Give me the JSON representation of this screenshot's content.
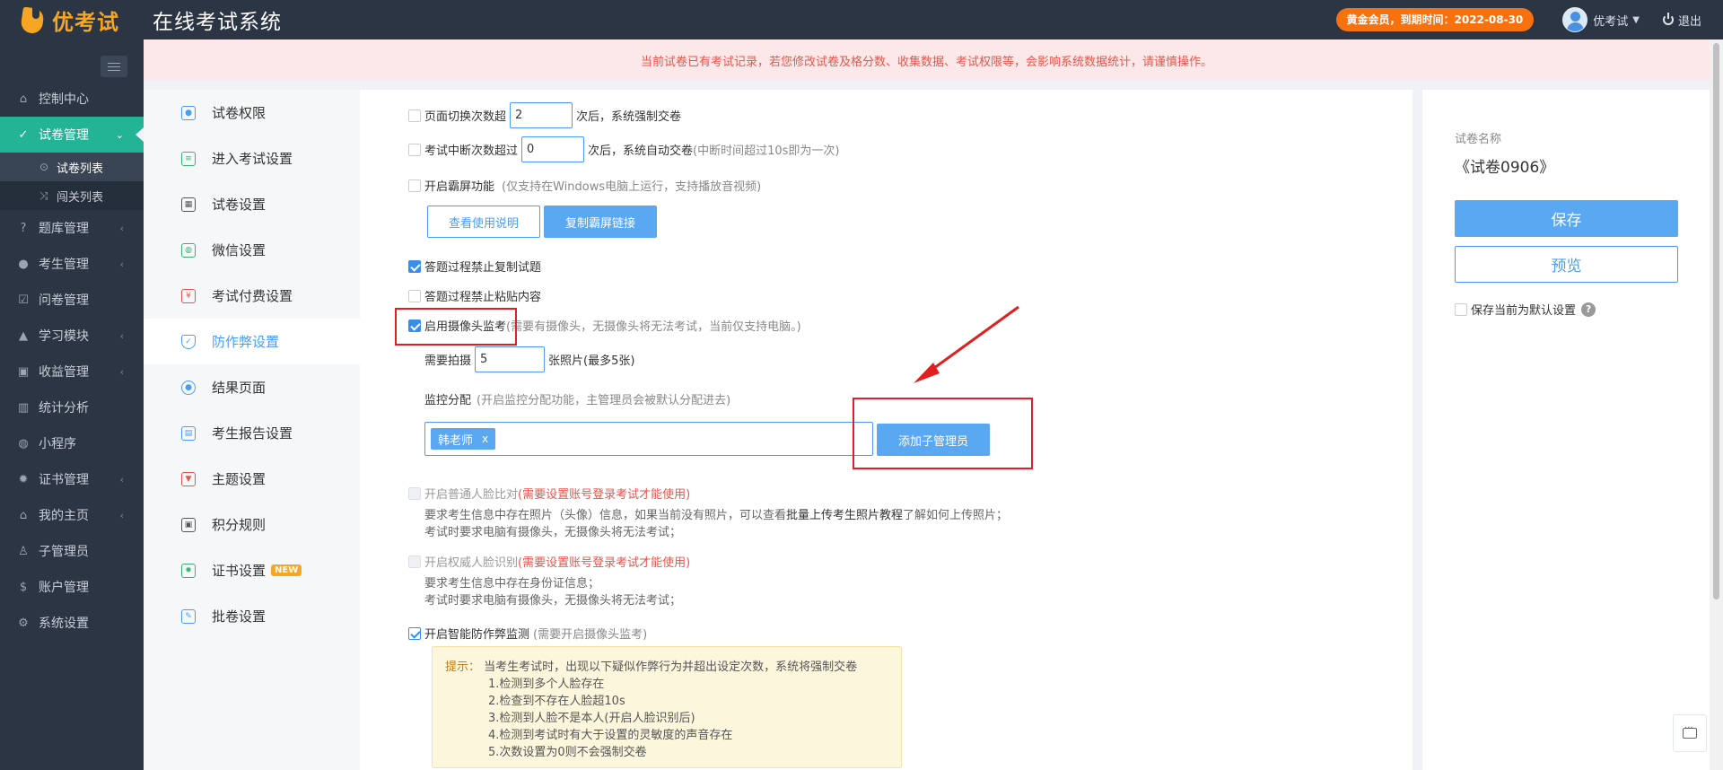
{
  "topbar": {
    "logo_text": "优考试",
    "system_title": "在线考试系统",
    "member_badge": "黄金会员，到期时间：2022-08-30",
    "username": "优考试",
    "logout": "退出"
  },
  "nav": {
    "items": [
      {
        "label": "控制中心",
        "icon": "home-icon"
      },
      {
        "label": "试卷管理",
        "icon": "check-circle-icon",
        "active": true
      },
      {
        "label": "题库管理",
        "icon": "question-icon"
      },
      {
        "label": "考生管理",
        "icon": "user-icon"
      },
      {
        "label": "问卷管理",
        "icon": "checkbox-icon"
      },
      {
        "label": "学习模块",
        "icon": "graduation-icon"
      },
      {
        "label": "收益管理",
        "icon": "money-icon"
      },
      {
        "label": "统计分析",
        "icon": "bar-chart-icon"
      },
      {
        "label": "小程序",
        "icon": "wechat-icon"
      },
      {
        "label": "证书管理",
        "icon": "certificate-icon"
      },
      {
        "label": "我的主页",
        "icon": "bank-icon"
      },
      {
        "label": "子管理员",
        "icon": "sub-admin-icon"
      },
      {
        "label": "账户管理",
        "icon": "dollar-icon"
      },
      {
        "label": "系统设置",
        "icon": "gear-icon"
      }
    ],
    "sub_items": [
      {
        "label": "试卷列表",
        "icon": "check-circle-icon"
      },
      {
        "label": "闯关列表",
        "icon": "shuffle-icon"
      }
    ]
  },
  "alert": {
    "text": "当前试卷已有考试记录，若您修改试卷及格分数、收集数据、考试权限等，会影响系统数据统计，请谨慎操作。"
  },
  "tabs": [
    {
      "label": "试卷权限",
      "color": "#4a9ef0"
    },
    {
      "label": "进入考试设置",
      "color": "#3cb371"
    },
    {
      "label": "试卷设置",
      "color": "#555555"
    },
    {
      "label": "微信设置",
      "color": "#3cb371"
    },
    {
      "label": "考试付费设置",
      "color": "#e2574c"
    },
    {
      "label": "防作弊设置",
      "color": "#4a9ef0",
      "active": true
    },
    {
      "label": "结果页面",
      "color": "#4a9ef0"
    },
    {
      "label": "考生报告设置",
      "color": "#4a9ef0"
    },
    {
      "label": "主题设置",
      "color": "#e2574c"
    },
    {
      "label": "积分规则",
      "color": "#555555"
    },
    {
      "label": "证书设置",
      "color": "#3cb371",
      "badge": "NEW"
    },
    {
      "label": "批卷设置",
      "color": "#4a9ef0"
    }
  ],
  "form": {
    "page_switch": {
      "label": "页面切换次数超",
      "value": "2",
      "suffix": "次后，系统强制交卷"
    },
    "interrupt": {
      "label": "考试中断次数超过",
      "value": "0",
      "suffix": "次后，系统自动交卷",
      "hint": "(中断时间超过10s即为一次)"
    },
    "fullscreen": {
      "label": "开启霸屏功能",
      "hint": "(仅支持在Windows电脑上运行，支持播放音视频)"
    },
    "view_guide_button": "查看使用说明",
    "copy_link_button": "复制霸屏链接",
    "no_copy": {
      "label": "答题过程禁止复制试题"
    },
    "no_paste": {
      "label": "答题过程禁止粘贴内容"
    },
    "camera": {
      "label": "启用摄像头监考",
      "hint": "(需要有摄像头，无摄像头将无法考试，当前仅支持电脑。)"
    },
    "photos": {
      "label": "需要拍摄",
      "value": "5",
      "suffix": "张照片(最多5张)"
    },
    "monitor": {
      "label": "监控分配",
      "hint": "(开启监控分配功能，主管理员会被默认分配进去)"
    },
    "assignee_tag": "韩老师",
    "tag_remove": "x",
    "add_sub_admin_button": "添加子管理员",
    "face_compare": {
      "label": "开启普通人脸比对",
      "hint": "(需要设置账号登录考试才能使用)",
      "desc1_pre": "要求考生信息中存在照片（头像）信息，如果当前没有照片，可以查看",
      "desc1_link": "批量上传考生照片教程",
      "desc1_post": "了解如何上传照片；",
      "desc2": "考试时要求电脑有摄像头，无摄像头将无法考试；"
    },
    "face_auth": {
      "label": "开启权威人脸识别",
      "hint": "(需要设置账号登录考试才能使用)",
      "desc1": "要求考生信息中存在身份证信息；",
      "desc2": "考试时要求电脑有摄像头，无摄像头将无法考试；"
    },
    "smart": {
      "label": "开启智能防作弊监测",
      "hint": "(需要开启摄像头监考)"
    },
    "tip": {
      "label": "提示：",
      "intro": "当考生考试时，出现以下疑似作弊行为并超出设定次数，系统将强制交卷",
      "items": [
        "1.检测到多个人脸存在",
        "2.检查到不存在人脸超10s",
        "3.检测到人脸不是本人(开启人脸识别后)",
        "4.检测到考试时有大于设置的灵敏度的声音存在",
        "5.次数设置为0则不会强制交卷"
      ]
    }
  },
  "right_panel": {
    "label": "试卷名称",
    "name": "《试卷0906》",
    "save_button": "保存",
    "preview_button": "预览",
    "default_label": "保存当前为默认设置",
    "help": "?"
  },
  "colors": {
    "accent": "#4a9ef0",
    "nav_active": "#23b395",
    "badge": "#f7720f",
    "annotation": "#e02020"
  }
}
